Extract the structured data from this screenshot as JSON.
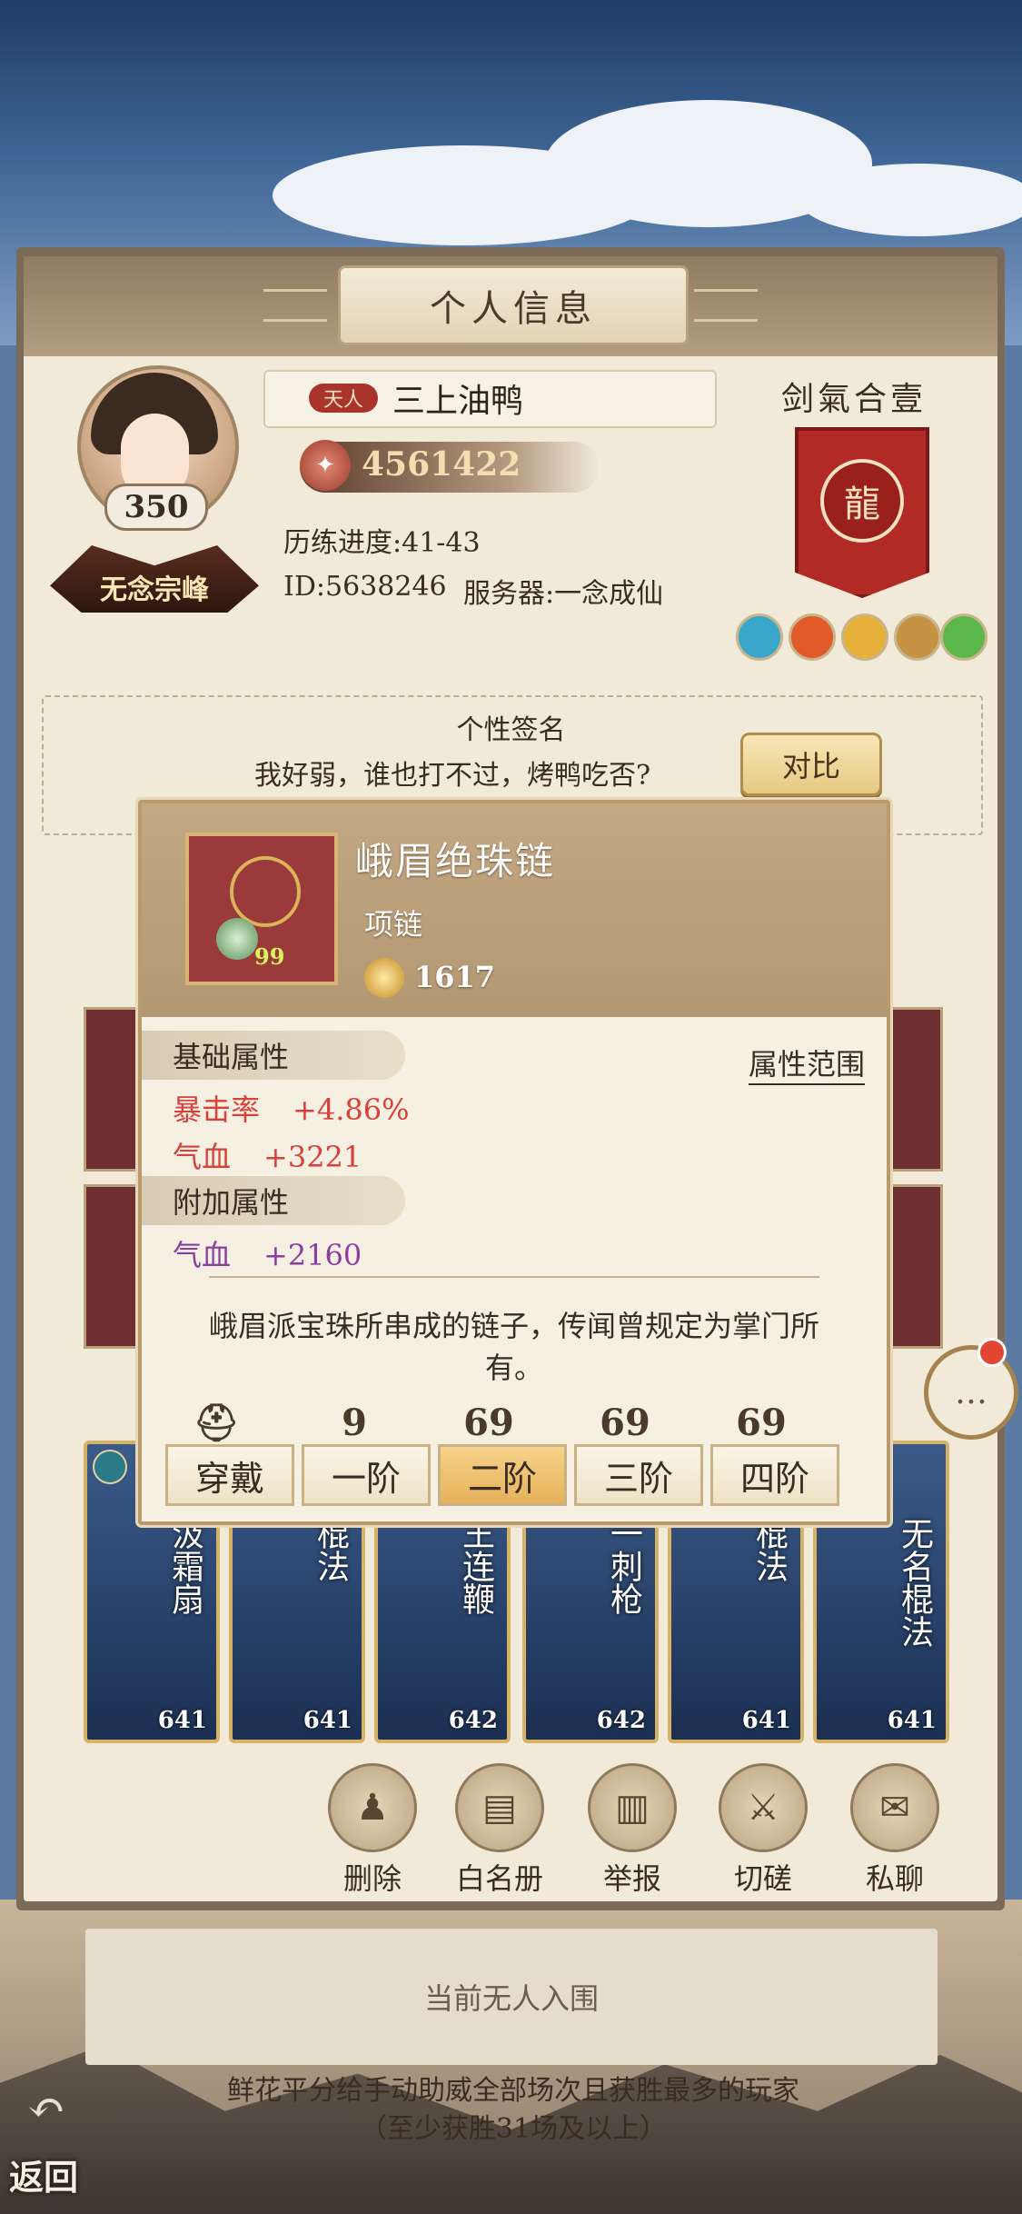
{
  "panel": {
    "title": "个人信息"
  },
  "profile": {
    "level": "350",
    "sect": "无念宗峰",
    "rank_tag": "天人",
    "name": "三上油鸭",
    "power": "4561422",
    "progress": "历练进度:41-43",
    "id_line": "ID:5638246",
    "server_line": "服务器:一念成仙"
  },
  "alliance": {
    "name": "剑氣合壹",
    "gems": [
      {
        "color": "#3aa6c9"
      },
      {
        "color": "#e05a2a"
      },
      {
        "color": "#e8b13a"
      },
      {
        "color": "#c69244"
      },
      {
        "color": "#5cb84a"
      }
    ]
  },
  "signature": {
    "label": "个性签名",
    "text": "我好弱，谁也打不过，烤鸭吃否?",
    "compare_label": "对比"
  },
  "item_popup": {
    "name": "峨眉绝珠链",
    "type": "项链",
    "power": "1617",
    "count": "99",
    "base_section": "基础属性",
    "range_label": "属性范围",
    "base_stats": [
      {
        "name": "暴击率",
        "value": "+4.86%",
        "color": "#d8403a"
      },
      {
        "name": "气血",
        "value": "+3221",
        "color": "#d8403a"
      }
    ],
    "extra_section": "附加属性",
    "extra_stats": [
      {
        "name": "气血",
        "value": "+2160",
        "color": "#8a3fa0"
      }
    ],
    "description": "峨眉派宝珠所串成的链子，传闻曾规定为掌门所有。",
    "tiers": [
      {
        "label": "穿戴",
        "icon": "armor-icon",
        "mark": "⛑"
      },
      {
        "label": "一阶",
        "icon": "tier1-icon",
        "mark": "9"
      },
      {
        "label": "二阶",
        "icon": "tier2-icon",
        "mark": "69"
      },
      {
        "label": "三阶",
        "icon": "tier3-icon",
        "mark": "69"
      },
      {
        "label": "四阶",
        "icon": "tier4-icon",
        "mark": "69"
      }
    ],
    "active_tier": 2
  },
  "cards": [
    {
      "name": "汲霜扇",
      "level": "641"
    },
    {
      "name": "棍法",
      "level": "641"
    },
    {
      "name": "王连鞭",
      "level": "642"
    },
    {
      "name": "一刺枪",
      "level": "642"
    },
    {
      "name": "棍法",
      "level": "641"
    },
    {
      "name": "无名棍法",
      "level": "641"
    }
  ],
  "actions": [
    {
      "label": "删除",
      "icon": "delete-icon"
    },
    {
      "label": "白名册",
      "icon": "whitelist-icon"
    },
    {
      "label": "举报",
      "icon": "report-icon"
    },
    {
      "label": "切磋",
      "icon": "spar-icon"
    },
    {
      "label": "私聊",
      "icon": "private-chat-icon"
    }
  ],
  "honor": {
    "empty_text": "当前无人入围",
    "footer": "鲜花平分给手动助威全部场次且获胜最多的玩家（至少获胜31场及以上）"
  },
  "back_label": "返回"
}
